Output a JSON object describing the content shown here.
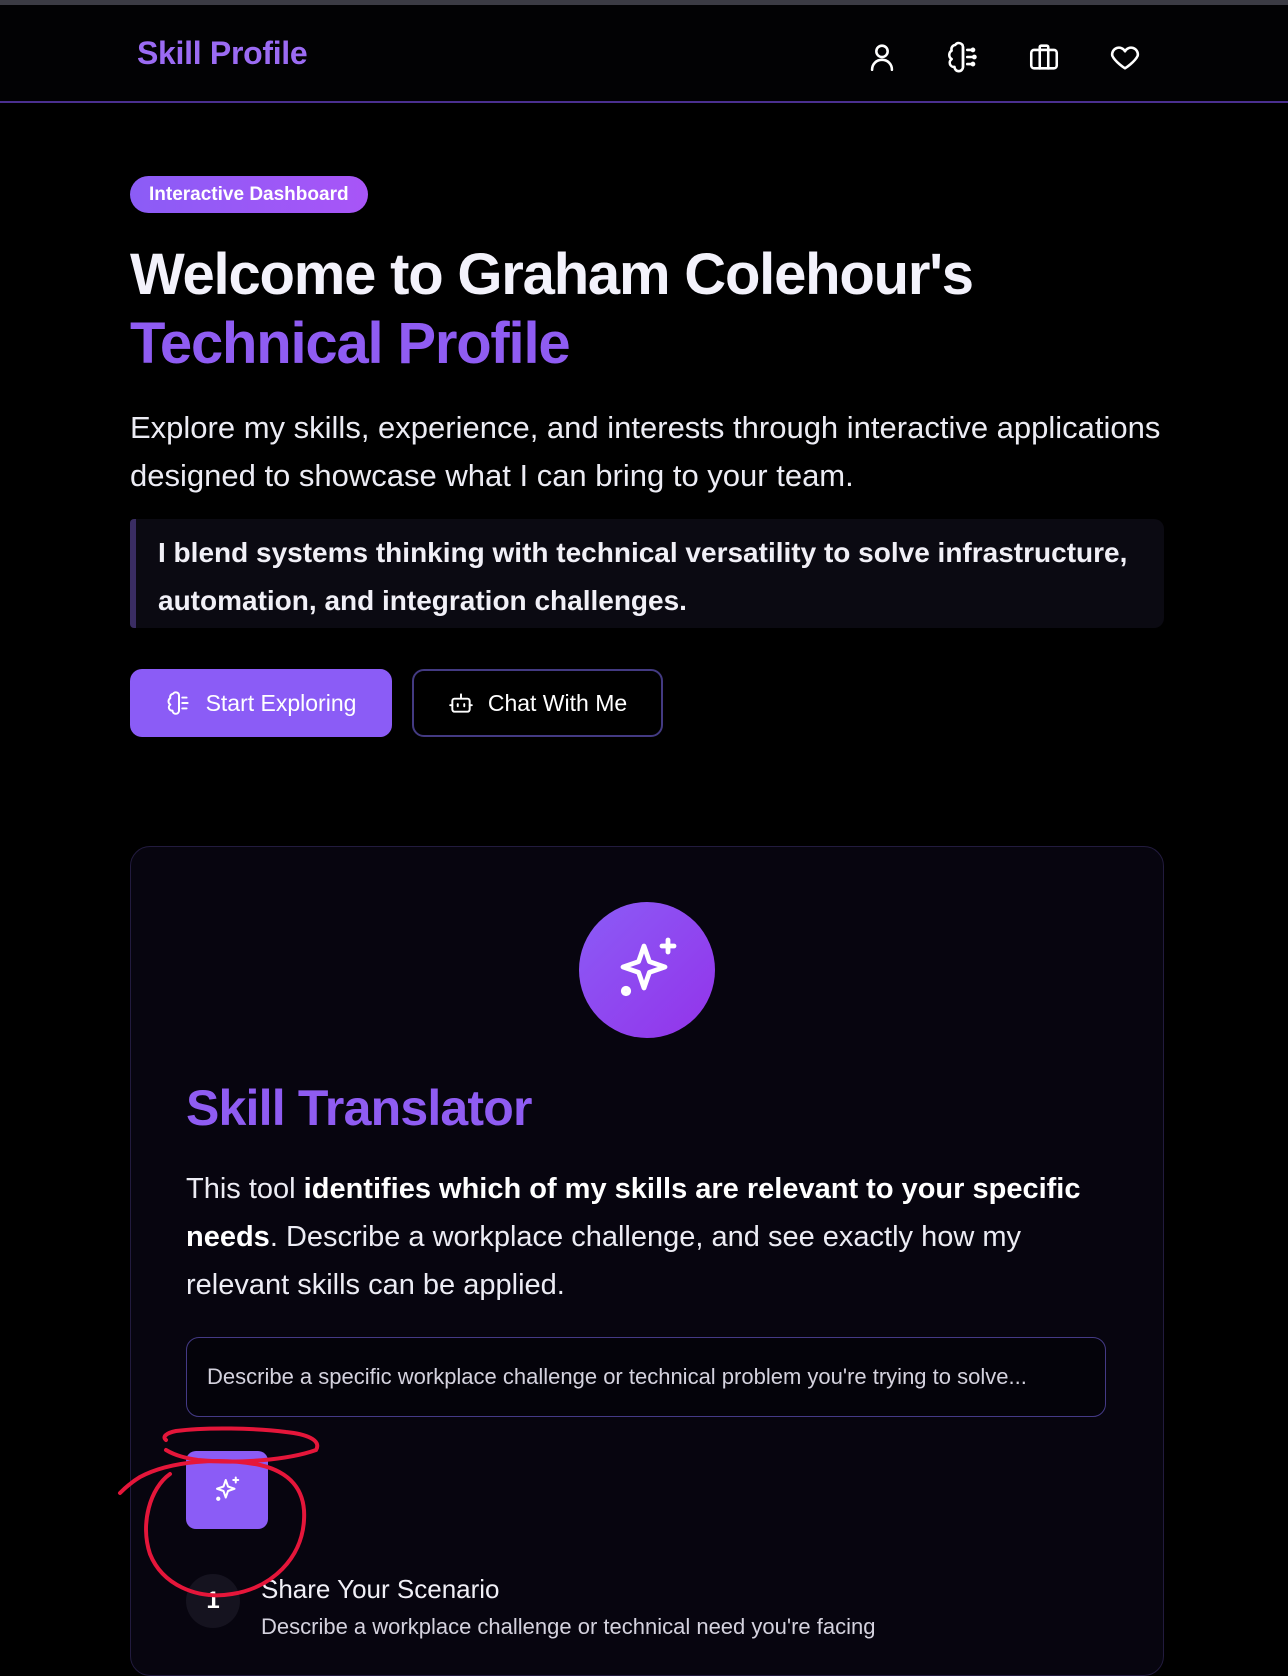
{
  "header": {
    "brand": "Skill Profile",
    "icons": [
      "user-icon",
      "brain-icon",
      "briefcase-icon",
      "heart-icon"
    ]
  },
  "hero": {
    "badge": "Interactive Dashboard",
    "title_line1": "Welcome to Graham Colehour's",
    "title_line2": "Technical Profile",
    "lead": "Explore my skills, experience, and interests through interactive applications designed to showcase what I can bring to your team.",
    "quote": "I blend systems thinking with technical versatility to solve infrastructure, automation, and integration challenges.",
    "primary_button": "Start Exploring",
    "secondary_button": "Chat With Me"
  },
  "translator": {
    "title": "Skill Translator",
    "desc_prefix": "This tool ",
    "desc_bold": "identifies which of my skills are relevant to your specific needs",
    "desc_suffix": ". Describe a workplace challenge, and see exactly how my relevant skills can be applied.",
    "input_placeholder": "Describe a specific workplace challenge or technical problem you're trying to solve...",
    "steps": [
      {
        "number": "1",
        "title": "Share Your Scenario",
        "desc": "Describe a workplace challenge or technical need you're facing"
      }
    ]
  },
  "colors": {
    "accent": "#8b5cf6",
    "accent_text": "#8f5cf2",
    "background": "#000000",
    "annotation": "#e5163a"
  }
}
